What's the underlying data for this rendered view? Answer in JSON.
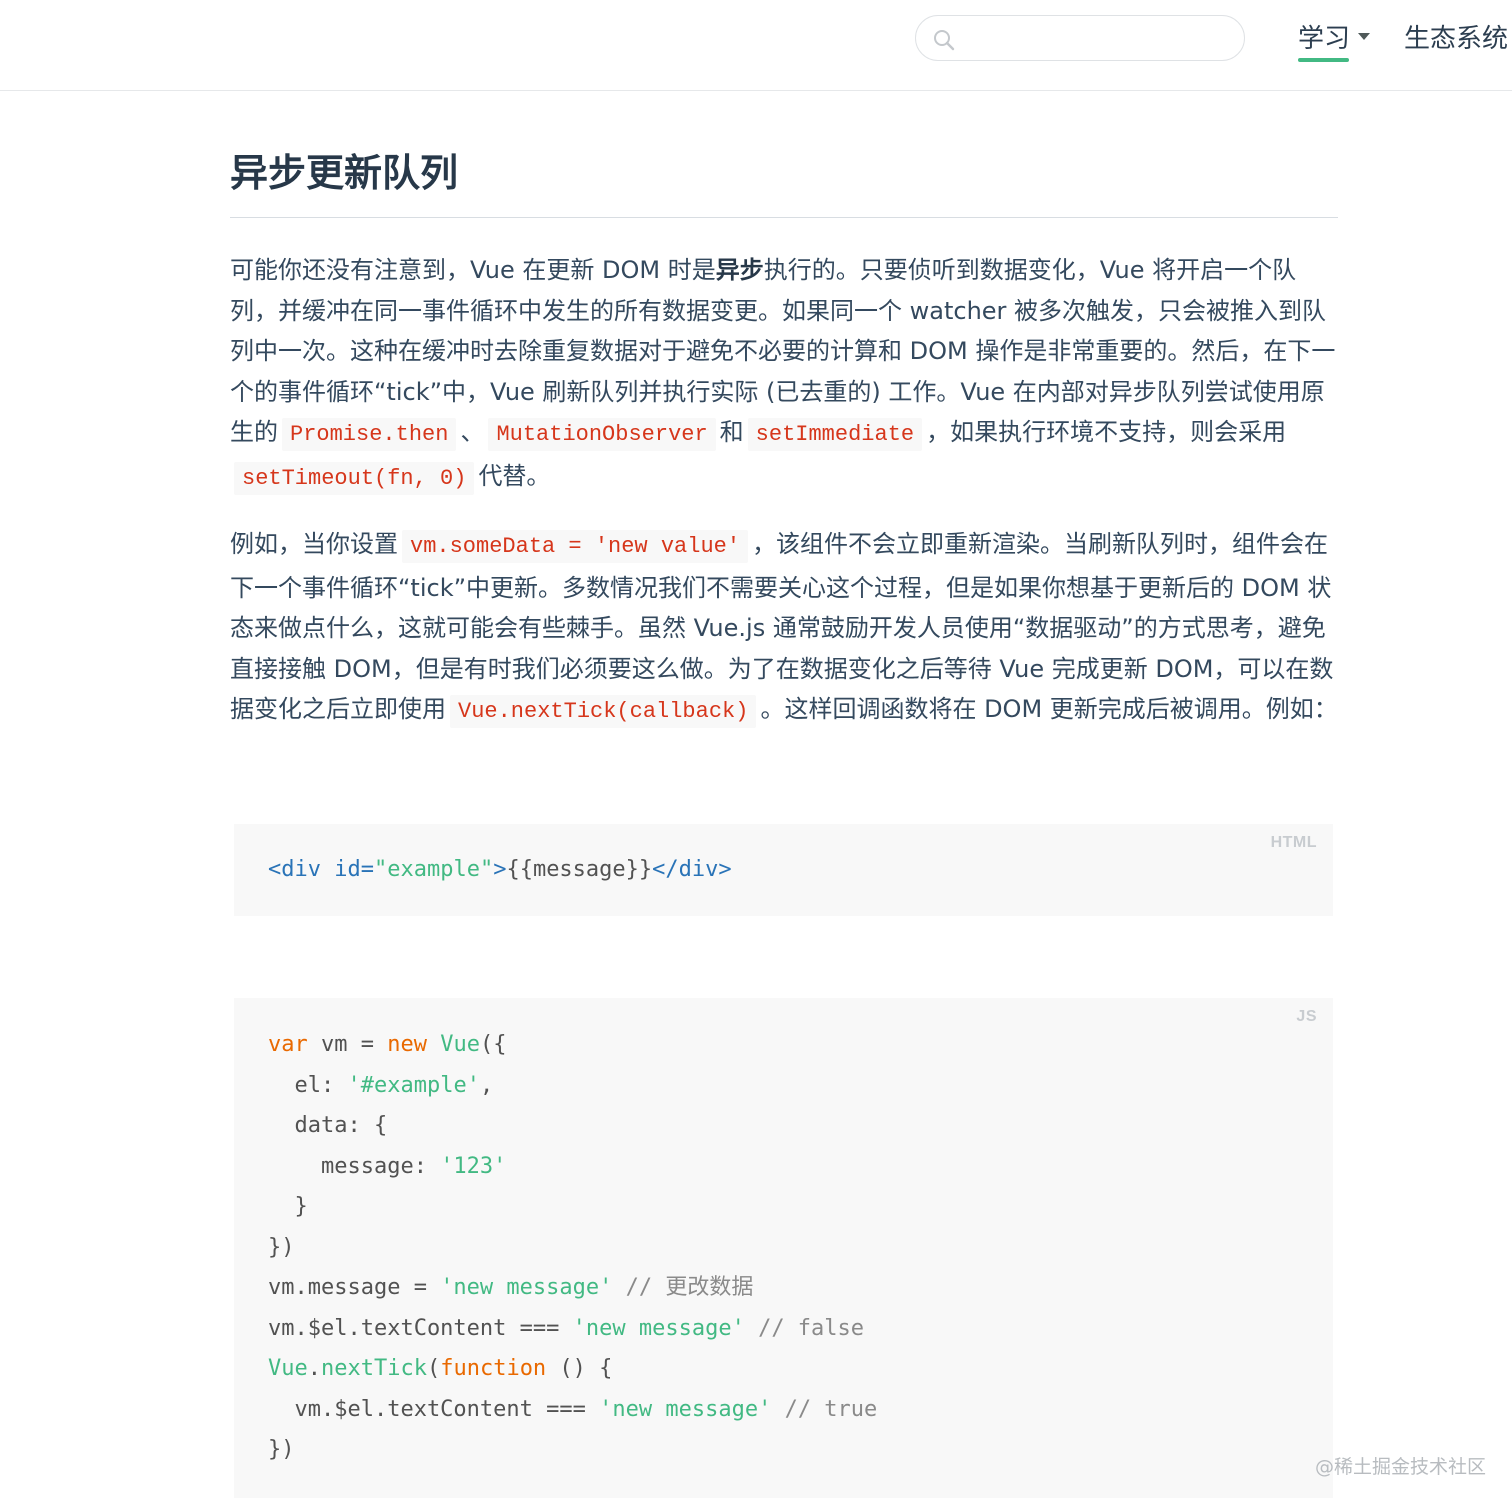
{
  "header": {
    "search": {
      "placeholder": "",
      "value": ""
    },
    "nav": [
      {
        "label": "学习",
        "active": true,
        "has_dropdown": true
      },
      {
        "label": "生态系统"
      }
    ],
    "accent_color": "#42b983"
  },
  "article": {
    "title": "异步更新队列",
    "p1": {
      "t1": "可能你还没有注意到，Vue 在更新 DOM 时是",
      "strong": "异步",
      "t2": "执行的。只要侦听到数据变化，Vue 将开启一个队列，并缓冲在同一事件循环中发生的所有数据变更。如果同一个 watcher 被多次触发，只会被推入到队列中一次。这种在缓冲时去除重复数据对于避免不必要的计算和 DOM 操作是非常重要的。然后，在下一个的事件循环“tick”中，Vue 刷新队列并执行实际 (已去重的) 工作。Vue 在内部对异步队列尝试使用原生的",
      "code1": "Promise.then",
      "t3": "、",
      "code2": "MutationObserver",
      "t4": "和",
      "code3": "setImmediate",
      "t5": "，如果执行环境不支持，则会采用",
      "code4": "setTimeout(fn, 0)",
      "t6": "代替。"
    },
    "p2": {
      "t1": "例如，当你设置",
      "code1": "vm.someData = 'new value'",
      "t2": "，该组件不会立即重新渲染。当刷新队列时，组件会在下一个事件循环“tick”中更新。多数情况我们不需要关心这个过程，但是如果你想基于更新后的 DOM 状态来做点什么，这就可能会有些棘手。虽然 Vue.js 通常鼓励开发人员使用“数据驱动”的方式思考，避免直接接触 DOM，但是有时我们必须要这么做。为了在数据变化之后等待 Vue 完成更新 DOM，可以在数据变化之后立即使用",
      "code2": "Vue.nextTick(callback)",
      "t3": "。这样回调函数将在 DOM 更新完成后被调用。例如："
    }
  },
  "code_html": {
    "lang": "HTML",
    "lines": [
      [
        {
          "t": "<div ",
          "c": "tag"
        },
        {
          "t": "id=",
          "c": "tag"
        },
        {
          "t": "\"example\"",
          "c": "str"
        },
        {
          "t": ">",
          "c": "tag"
        },
        {
          "t": "{{message}}",
          "c": "txt"
        },
        {
          "t": "</div>",
          "c": "tag"
        }
      ]
    ]
  },
  "code_js": {
    "lang": "JS",
    "lines": [
      [
        {
          "t": "var",
          "c": "kw"
        },
        {
          "t": " vm = ",
          "c": "plain"
        },
        {
          "t": "new",
          "c": "kw"
        },
        {
          "t": " ",
          "c": "plain"
        },
        {
          "t": "Vue",
          "c": "fn"
        },
        {
          "t": "({",
          "c": "plain"
        }
      ],
      [
        {
          "t": "  el: ",
          "c": "plain"
        },
        {
          "t": "'#example'",
          "c": "str"
        },
        {
          "t": ",",
          "c": "plain"
        }
      ],
      [
        {
          "t": "  data: {",
          "c": "plain"
        }
      ],
      [
        {
          "t": "    message: ",
          "c": "plain"
        },
        {
          "t": "'123'",
          "c": "str"
        }
      ],
      [
        {
          "t": "  }",
          "c": "plain"
        }
      ],
      [
        {
          "t": "})",
          "c": "plain"
        }
      ],
      [
        {
          "t": "vm.message = ",
          "c": "plain"
        },
        {
          "t": "'new message'",
          "c": "str"
        },
        {
          "t": " // 更改数据",
          "c": "com"
        }
      ],
      [
        {
          "t": "vm.$el.textContent === ",
          "c": "plain"
        },
        {
          "t": "'new message'",
          "c": "str"
        },
        {
          "t": " // false",
          "c": "com"
        }
      ],
      [
        {
          "t": "Vue",
          "c": "fn"
        },
        {
          "t": ".",
          "c": "plain"
        },
        {
          "t": "nextTick",
          "c": "fn"
        },
        {
          "t": "(",
          "c": "plain"
        },
        {
          "t": "function",
          "c": "kw"
        },
        {
          "t": " () {",
          "c": "plain"
        }
      ],
      [
        {
          "t": "  vm.$el.textContent === ",
          "c": "plain"
        },
        {
          "t": "'new message'",
          "c": "str"
        },
        {
          "t": " // true",
          "c": "com"
        }
      ],
      [
        {
          "t": "})",
          "c": "plain"
        }
      ]
    ]
  },
  "watermark": "@稀土掘金技术社区"
}
